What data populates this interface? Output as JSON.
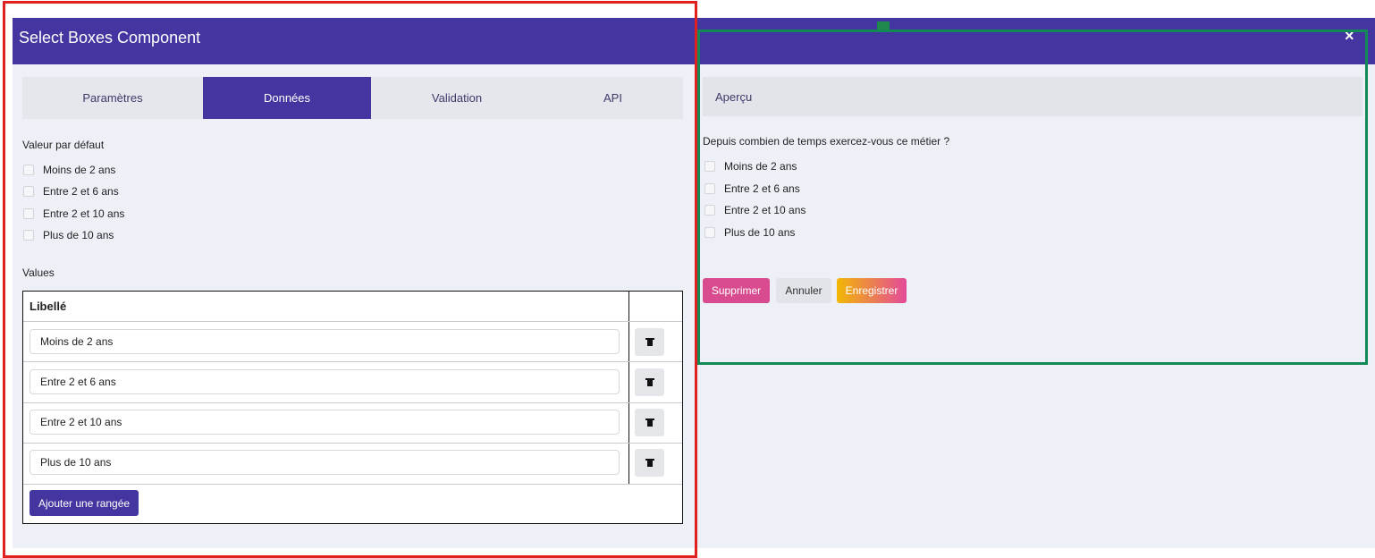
{
  "dialog": {
    "title": "Select Boxes Component",
    "close_label": "×"
  },
  "tabs": [
    {
      "label": "Paramètres",
      "active": false
    },
    {
      "label": "Données",
      "active": true
    },
    {
      "label": "Validation",
      "active": false
    },
    {
      "label": "API",
      "active": false
    }
  ],
  "default_value": {
    "label": "Valeur par défaut",
    "options": [
      "Moins de 2 ans",
      "Entre 2 et 6 ans",
      "Entre 2 et 10 ans",
      "Plus de 10 ans"
    ]
  },
  "values": {
    "label": "Values",
    "column_header": "Libellé",
    "rows": [
      "Moins de 2 ans",
      "Entre 2 et 6 ans",
      "Entre 2  et 10 ans",
      "Plus de 10 ans"
    ],
    "add_row_label": "Ajouter une rangée"
  },
  "preview": {
    "header": "Aperçu",
    "question": "Depuis combien de temps exercez-vous ce métier ?",
    "options": [
      "Moins de 2 ans",
      "Entre 2 et 6 ans",
      "Entre 2 et 10 ans",
      "Plus de 10 ans"
    ]
  },
  "actions": {
    "delete": "Supprimer",
    "cancel": "Annuler",
    "save": "Enregistrer"
  },
  "colors": {
    "primary": "#4336a0",
    "danger": "#d94b8f",
    "highlight_red": "#e02020",
    "highlight_green": "#138a55"
  }
}
